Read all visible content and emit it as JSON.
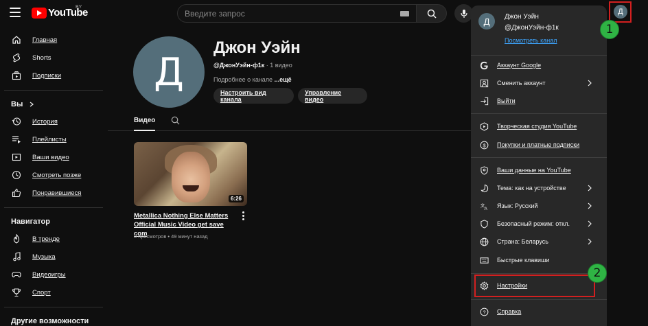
{
  "header": {
    "logo_text": "YouTube",
    "region": "BY",
    "search_placeholder": "Введите запрос"
  },
  "account": {
    "initial": "Д"
  },
  "sidebar": {
    "main": [
      {
        "label": "Главная",
        "icon": "home-icon"
      },
      {
        "label": "Shorts",
        "icon": "shorts-icon"
      },
      {
        "label": "Подписки",
        "icon": "subscriptions-icon"
      }
    ],
    "you_heading": "Вы",
    "you_items": [
      {
        "label": "История",
        "icon": "history-icon"
      },
      {
        "label": "Плейлисты",
        "icon": "playlists-icon"
      },
      {
        "label": "Ваши видео",
        "icon": "your-videos-icon"
      },
      {
        "label": "Смотреть позже",
        "icon": "watch-later-icon"
      },
      {
        "label": "Понравившиеся",
        "icon": "liked-icon"
      }
    ],
    "navigator_heading": "Навигатор",
    "navigator_items": [
      {
        "label": "В тренде",
        "icon": "trending-icon"
      },
      {
        "label": "Музыка",
        "icon": "music-icon"
      },
      {
        "label": "Видеоигры",
        "icon": "gaming-icon"
      },
      {
        "label": "Спорт",
        "icon": "sports-icon"
      }
    ],
    "more_heading": "Другие возможности"
  },
  "channel": {
    "initial": "Д",
    "name": "Джон Уэйн",
    "handle": "@ДжонУэйн-ф1к",
    "meta_rest": " · 1 видео",
    "desc_prefix": "Подробнее о канале ",
    "desc_more": "...ещё",
    "customize_button": "Настроить вид канала",
    "manage_button": "Управление видео",
    "tab_videos": "Видео"
  },
  "video": {
    "duration": "6:26",
    "title": "Metallica Nothing Else Matters Official Music Video get save com",
    "stats": "0 просмотров • 49 минут назад"
  },
  "menu": {
    "initial": "Д",
    "name": "Джон Уэйн",
    "handle": "@ДжонУэйн-ф1к",
    "view_channel": "Посмотреть канал",
    "items": [
      {
        "label": "Аккаунт Google",
        "icon": "google-icon"
      },
      {
        "label": "Сменить аккаунт",
        "icon": "switch-account-icon"
      },
      {
        "label": "Выйти",
        "icon": "sign-out-icon"
      },
      {
        "label": "Творческая студия YouTube",
        "icon": "studio-icon"
      },
      {
        "label": "Покупки и платные подписки",
        "icon": "purchases-icon"
      },
      {
        "label": "Ваши данные на YouTube",
        "icon": "your-data-icon"
      },
      {
        "label": "Тема: как на устройстве",
        "icon": "theme-icon"
      },
      {
        "label": "Язык: Русский",
        "icon": "language-icon"
      },
      {
        "label": "Безопасный режим: откл.",
        "icon": "restricted-mode-icon"
      },
      {
        "label": "Страна: Беларусь",
        "icon": "location-icon"
      },
      {
        "label": "Быстрые клавиши",
        "icon": "keyboard-icon"
      },
      {
        "label": "Настройки",
        "icon": "settings-icon"
      },
      {
        "label": "Справка",
        "icon": "help-icon"
      }
    ]
  },
  "annotations": {
    "step1": "1",
    "step2": "2"
  },
  "colors": {
    "background": "#0f0f0f",
    "menu_bg": "#282828",
    "avatar": "#546e7a",
    "link": "#3ea6ff",
    "highlight": "#d32020",
    "badge": "#2fb344"
  }
}
